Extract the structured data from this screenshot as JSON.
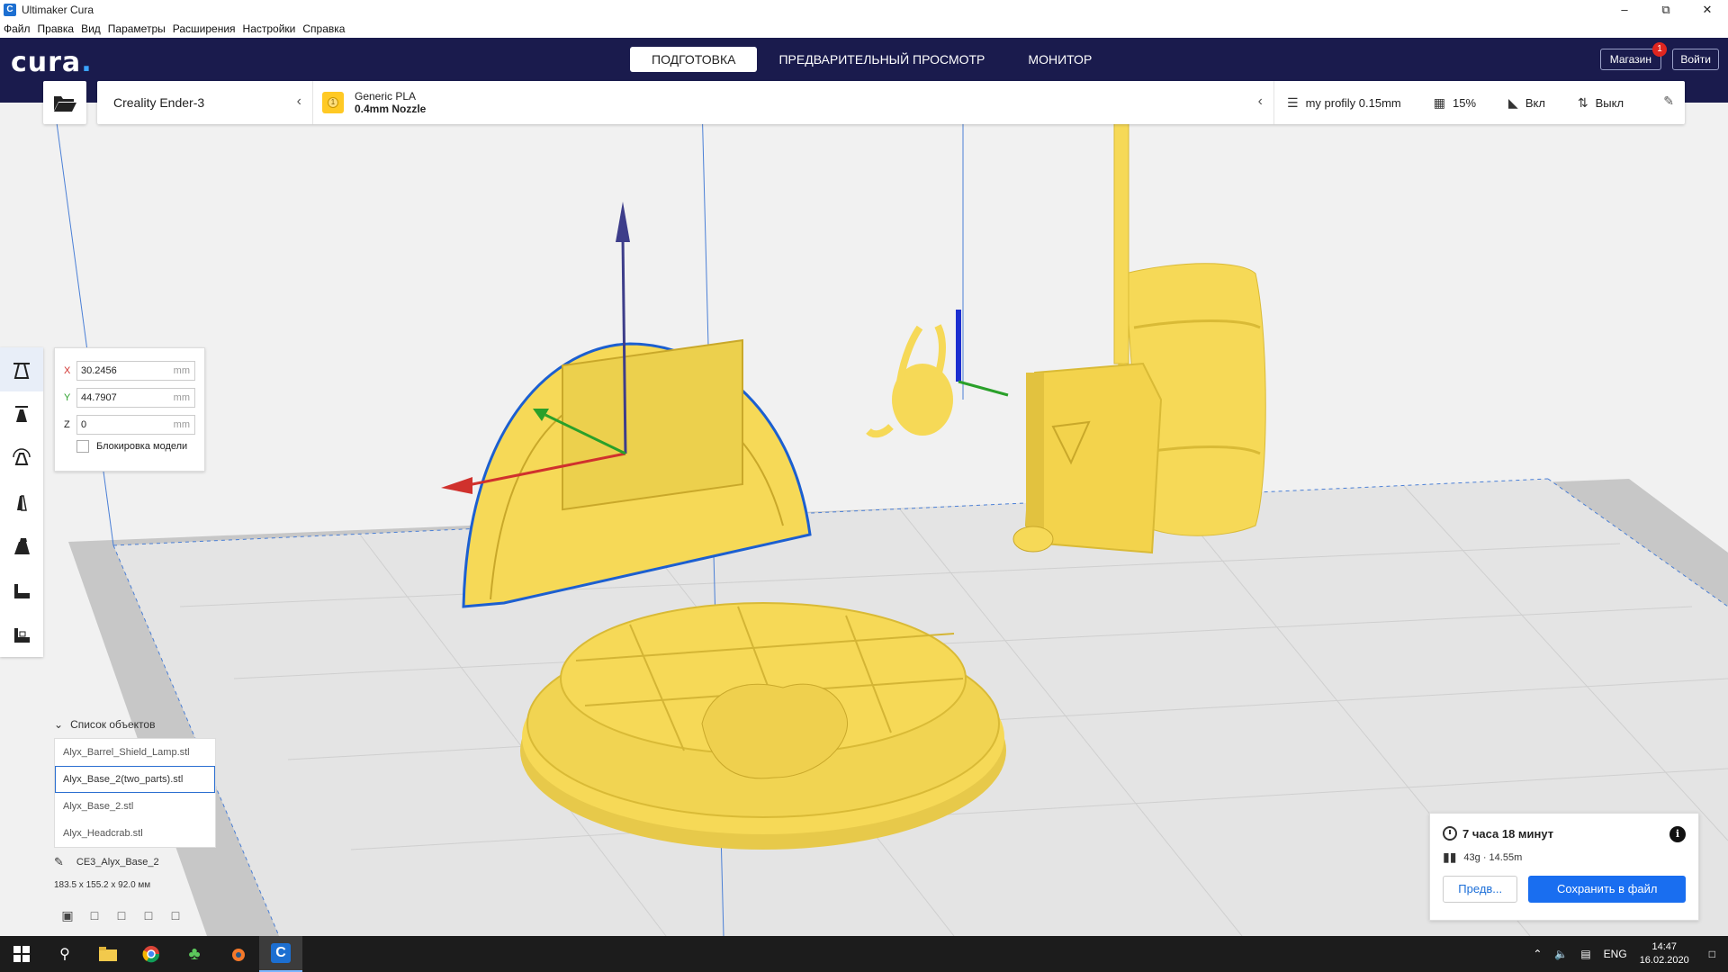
{
  "window": {
    "title": "Ultimaker Cura",
    "app_icon": "C",
    "controls": [
      "–",
      "⧉",
      "✕"
    ]
  },
  "menu": [
    "Файл",
    "Правка",
    "Вид",
    "Параметры",
    "Расширения",
    "Настройки",
    "Справка"
  ],
  "header": {
    "logo": "cura",
    "logo_dot": ".",
    "tabs": [
      {
        "label": "ПОДГОТОВКА",
        "active": true
      },
      {
        "label": "ПРЕДВАРИТЕЛЬНЫЙ ПРОСМОТР",
        "active": false
      },
      {
        "label": "МОНИТОР",
        "active": false
      }
    ],
    "store_label": "Магазин",
    "store_badge": "1",
    "login_label": "Войти"
  },
  "printer": {
    "name": "Creality Ender-3",
    "material_badge": "1",
    "material_line1": "Generic PLA",
    "material_line2": "0.4mm Nozzle",
    "profile": "my profily 0.15mm",
    "infill": "15%",
    "support": "Вкл",
    "adhesion": "Выкл"
  },
  "move_panel": {
    "x_label": "X",
    "x_value": "30.2456",
    "y_label": "Y",
    "y_value": "44.7907",
    "z_label": "Z",
    "z_value": "0",
    "unit": "mm",
    "lock_label": "Блокировка модели",
    "axis_colors": {
      "x": "#d0312d",
      "y": "#2aa02a",
      "z": "#333333"
    }
  },
  "object_list": {
    "header": "Список объектов",
    "items": [
      "Alyx_Barrel_Shield_Lamp.stl",
      "Alyx_Base_2(two_parts).stl",
      "Alyx_Base_2.stl",
      "Alyx_Headcrab.stl"
    ],
    "selected_index": 1
  },
  "job": {
    "name": "CE3_Alyx_Base_2",
    "dimensions": "183.5 x 155.2 x 92.0 мм"
  },
  "print_info": {
    "time": "7 часа 18 минут",
    "info_icon": "i",
    "material": "43g · 14.55m",
    "preview_label": "Предв...",
    "save_label": "Сохранить в файл"
  },
  "colors": {
    "header_bg": "#1a1b4d",
    "model_yellow": "#f6d957",
    "accent_blue": "#196ef0"
  },
  "taskbar": {
    "lang": "ENG",
    "time": "14:47",
    "date": "16.02.2020"
  }
}
